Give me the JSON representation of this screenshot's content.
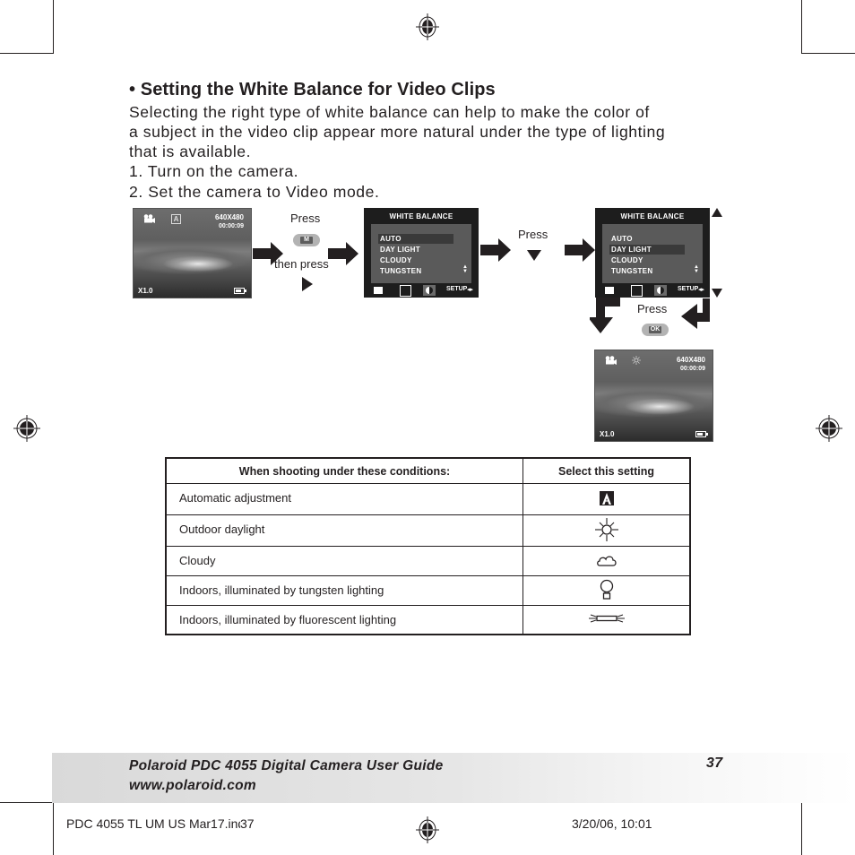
{
  "heading": "• Setting the White Balance for Video Clips",
  "intro_lines": [
    "Selecting the right type of white balance can help to make the color of",
    "a subject in the video clip appear more natural under the type of lighting",
    "that is available."
  ],
  "steps": [
    "1.  Turn on the camera.",
    "2.  Set the camera to Video mode."
  ],
  "diagram": {
    "preview_screen": {
      "resolution": "640X480",
      "time": "00:00:09",
      "zoom": "X1.0",
      "mode_icon": "video-camera-icon",
      "wb_icon": "auto-wb-icon",
      "battery_icon": "battery-icon"
    },
    "step1_press": "Press",
    "step1_button": "M",
    "step1_then": "then press",
    "step2_press": "Press",
    "step3_press": "Press",
    "step3_button": "OK",
    "menu_screen": {
      "title": "WHITE BALANCE",
      "items": [
        "AUTO",
        "DAY LIGHT",
        "CLOUDY",
        "TUNGSTEN"
      ],
      "bottom_setup": "SETUP",
      "first_selected": "AUTO",
      "second_selected": "DAY LIGHT"
    },
    "result_screen": {
      "resolution": "640X480",
      "time": "00:00:09",
      "zoom": "X1.0",
      "wb_icon": "daylight-icon"
    }
  },
  "table": {
    "headers": [
      "When shooting under these conditions:",
      "Select this setting"
    ],
    "rows": [
      {
        "condition": "Automatic adjustment",
        "icon": "auto-wb-icon"
      },
      {
        "condition": "Outdoor daylight",
        "icon": "sun-icon"
      },
      {
        "condition": "Cloudy",
        "icon": "cloud-icon"
      },
      {
        "condition": "Indoors, illuminated by tungsten lighting",
        "icon": "bulb-icon"
      },
      {
        "condition": "Indoors, illuminated by fluorescent lighting",
        "icon": "fluorescent-icon"
      }
    ]
  },
  "footer": {
    "guide_title": "Polaroid PDC 4055 Digital Camera User Guide",
    "url": "www.polaroid.com",
    "page_number": "37"
  },
  "slug": {
    "file": "PDC 4055 TL UM US Mar17.indd",
    "page_overlay": "37",
    "datetime": "3/20/06, 10:01"
  }
}
